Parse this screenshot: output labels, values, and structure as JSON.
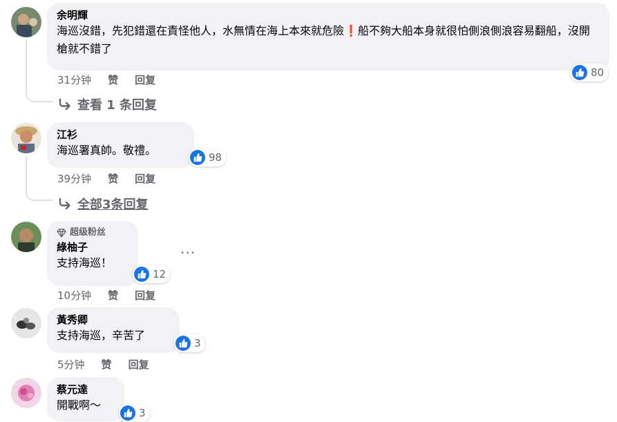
{
  "comments": [
    {
      "author": "余明輝",
      "text": "海巡沒錯，先犯錯還在責怪他人，水無情在海上本來就危險❗️船不夠大船本身就很怕側浪側浪容易翻船，沒開槍就不錯了",
      "time": "31分钟",
      "like_label": "赞",
      "reply_label": "回复",
      "reactions": "80",
      "replies_label": "查看 1 条回复"
    },
    {
      "author": "江衫",
      "text": "海巡署真帥。敬禮。",
      "time": "39分钟",
      "like_label": "赞",
      "reply_label": "回复",
      "reactions": "98",
      "replies_label": "全部3条回复"
    },
    {
      "badge": "超级粉丝",
      "author": "綠柚子",
      "text": "支持海巡！",
      "time": "10分钟",
      "like_label": "赞",
      "reply_label": "回复",
      "reactions": "12"
    },
    {
      "author": "黃秀卿",
      "text": "支持海巡，辛苦了",
      "time": "5分钟",
      "like_label": "赞",
      "reply_label": "回复",
      "reactions": "3"
    },
    {
      "author": "蔡元達",
      "text": "開戰啊～",
      "reactions": "3"
    }
  ],
  "more_menu": "···"
}
